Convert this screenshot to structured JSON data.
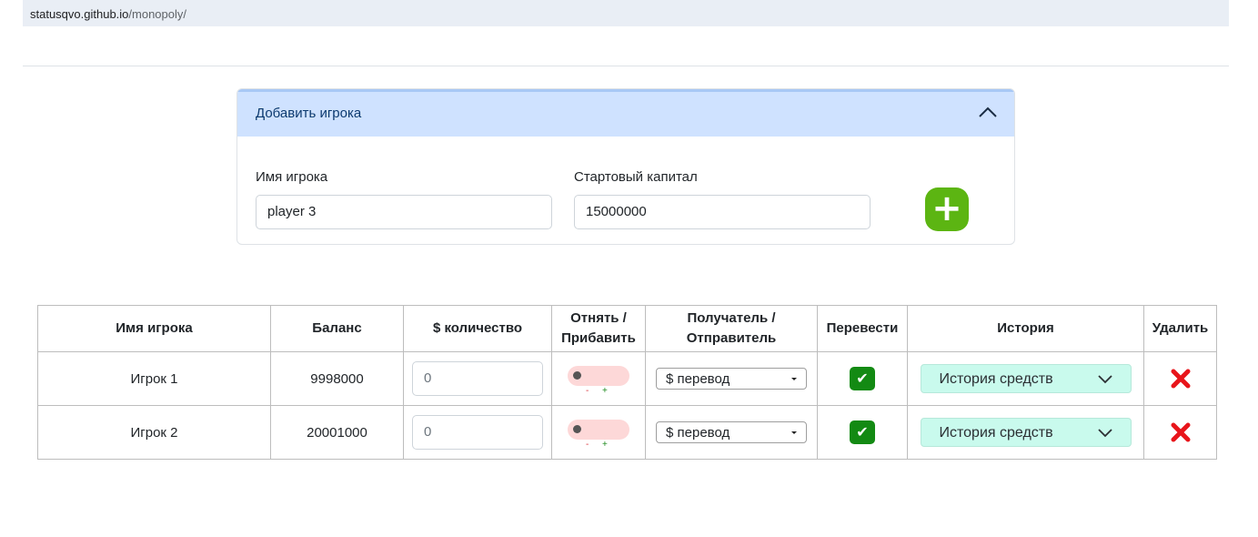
{
  "browser": {
    "url_host": "statusqvo.github.io",
    "url_path": "/monopoly/"
  },
  "accordion": {
    "title": "Добавить игрока",
    "name_label": "Имя игрока",
    "name_value": "player 3",
    "capital_label": "Стартовый капитал",
    "capital_value": "15000000",
    "add_button": "+"
  },
  "table": {
    "headers": {
      "name": "Имя игрока",
      "balance": "Баланс",
      "amount": "$ количество",
      "toggle_line1": "Отнять /",
      "toggle_line2": "Прибавить",
      "recipient_line1": "Получатель /",
      "recipient_line2": "Отправитель",
      "transfer": "Перевести",
      "history": "История",
      "delete": "Удалить"
    },
    "rows": [
      {
        "name": "Игрок 1",
        "balance": "9998000",
        "amount_placeholder": "0",
        "minus": "-",
        "plus": "+",
        "select": "$ перевод",
        "history": "История средств"
      },
      {
        "name": "Игрок 2",
        "balance": "20001000",
        "amount_placeholder": "0",
        "minus": "-",
        "plus": "+",
        "select": "$ перевод",
        "history": "История средств"
      }
    ]
  },
  "icons": {
    "check": "✔",
    "delete_color": "#e8151b",
    "accent": "#5cb512"
  }
}
